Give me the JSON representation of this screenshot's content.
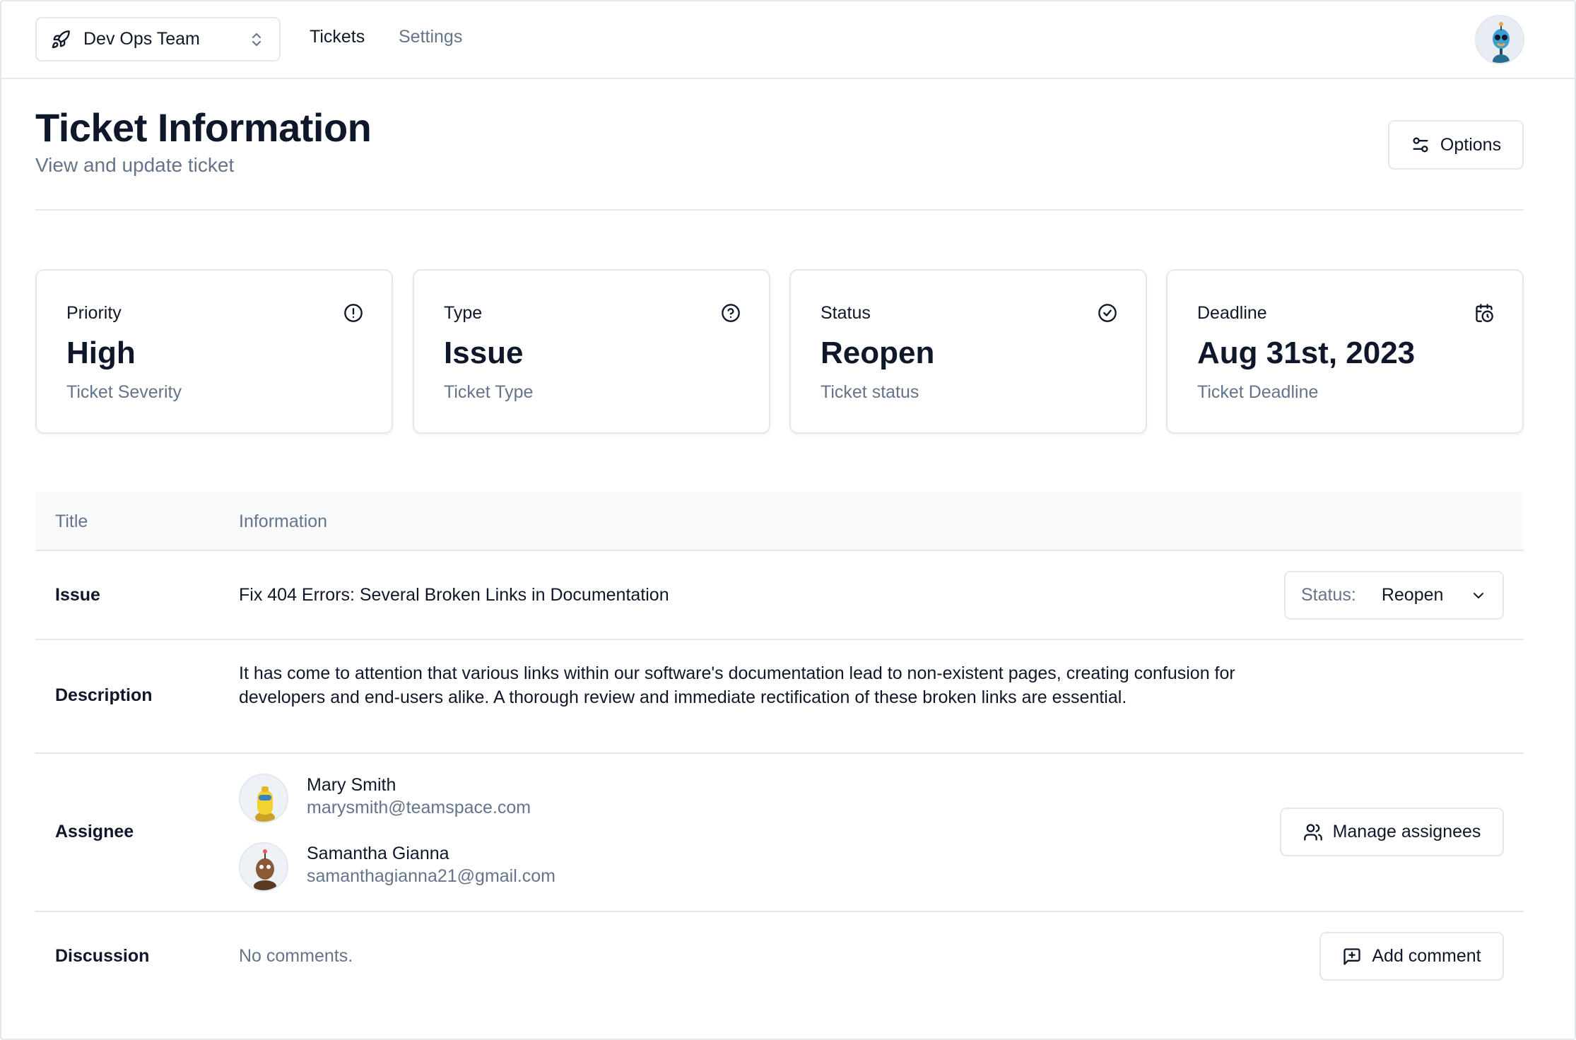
{
  "nav": {
    "team_name": "Dev Ops Team",
    "links": [
      {
        "label": "Tickets"
      },
      {
        "label": "Settings"
      }
    ]
  },
  "header": {
    "title": "Ticket Information",
    "subtitle": "View and update ticket",
    "options_label": "Options"
  },
  "cards": [
    {
      "label": "Priority",
      "value": "High",
      "sub": "Ticket Severity",
      "icon": "alert-circle-icon"
    },
    {
      "label": "Type",
      "value": "Issue",
      "sub": "Ticket Type",
      "icon": "help-circle-icon"
    },
    {
      "label": "Status",
      "value": "Reopen",
      "sub": "Ticket status",
      "icon": "check-circle-icon"
    },
    {
      "label": "Deadline",
      "value": "Aug 31st, 2023",
      "sub": "Ticket Deadline",
      "icon": "calendar-clock-icon"
    }
  ],
  "table": {
    "headers": [
      "Title",
      "Information"
    ],
    "issue": {
      "label": "Issue",
      "text": "Fix 404 Errors: Several Broken Links in Documentation",
      "status_key": "Status:",
      "status_value": "Reopen"
    },
    "description": {
      "label": "Description",
      "text": "It has come to attention that various links within our software's documentation lead to non-existent pages, creating confusion for developers and end-users alike. A thorough review and immediate rectification of these broken links are essential."
    },
    "assignee": {
      "label": "Assignee",
      "people": [
        {
          "name": "Mary Smith",
          "email": "marysmith@teamspace.com"
        },
        {
          "name": "Samantha Gianna",
          "email": "samanthagianna21@gmail.com"
        }
      ],
      "manage_label": "Manage assignees"
    },
    "discussion": {
      "label": "Discussion",
      "empty_text": "No comments.",
      "add_label": "Add comment"
    }
  },
  "colors": {
    "text": "#0f172a",
    "muted": "#64748b",
    "border": "#e2e8f0",
    "header_bg": "#f8fafc"
  }
}
